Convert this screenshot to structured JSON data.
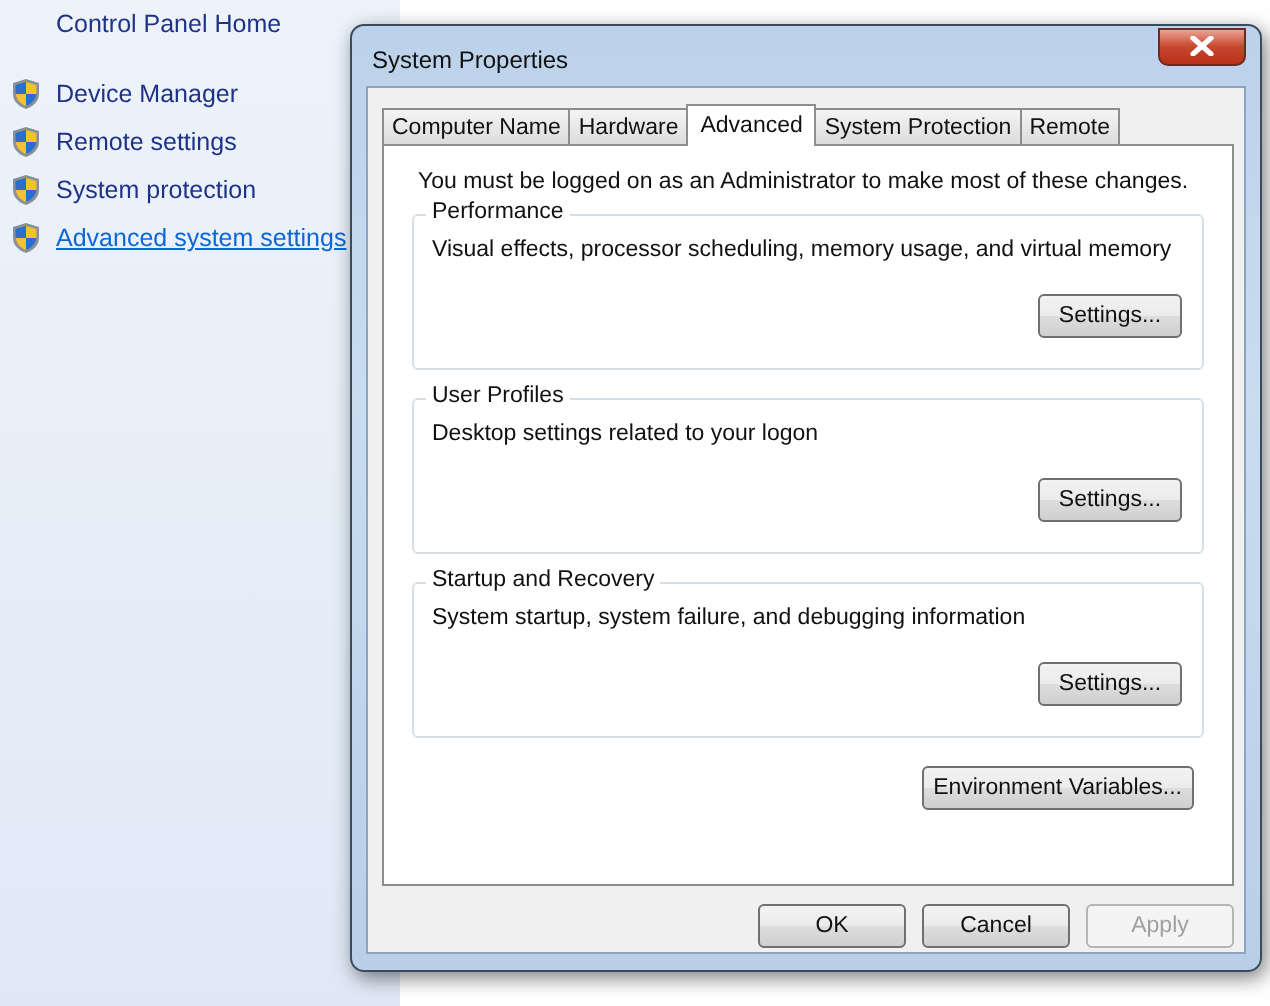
{
  "sidebar": {
    "home": "Control Panel Home",
    "items": [
      {
        "label": "Device Manager",
        "link": false
      },
      {
        "label": "Remote settings",
        "link": false
      },
      {
        "label": "System protection",
        "link": false
      },
      {
        "label": "Advanced system settings",
        "link": true
      }
    ]
  },
  "dialog": {
    "title": "System Properties",
    "tabs": [
      {
        "label": "Computer Name",
        "selected": false
      },
      {
        "label": "Hardware",
        "selected": false
      },
      {
        "label": "Advanced",
        "selected": true
      },
      {
        "label": "System Protection",
        "selected": false
      },
      {
        "label": "Remote",
        "selected": false
      }
    ],
    "notice": "You must be logged on as an Administrator to make most of these changes.",
    "groups": [
      {
        "title": "Performance",
        "text": "Visual effects, processor scheduling, memory usage, and virtual memory",
        "button": "Settings..."
      },
      {
        "title": "User Profiles",
        "text": "Desktop settings related to your logon",
        "button": "Settings..."
      },
      {
        "title": "Startup and Recovery",
        "text": "System startup, system failure, and debugging information",
        "button": "Settings..."
      }
    ],
    "env_button": "Environment Variables...",
    "buttons": [
      {
        "label": "OK",
        "disabled": false
      },
      {
        "label": "Cancel",
        "disabled": false
      },
      {
        "label": "Apply",
        "disabled": true
      }
    ]
  }
}
